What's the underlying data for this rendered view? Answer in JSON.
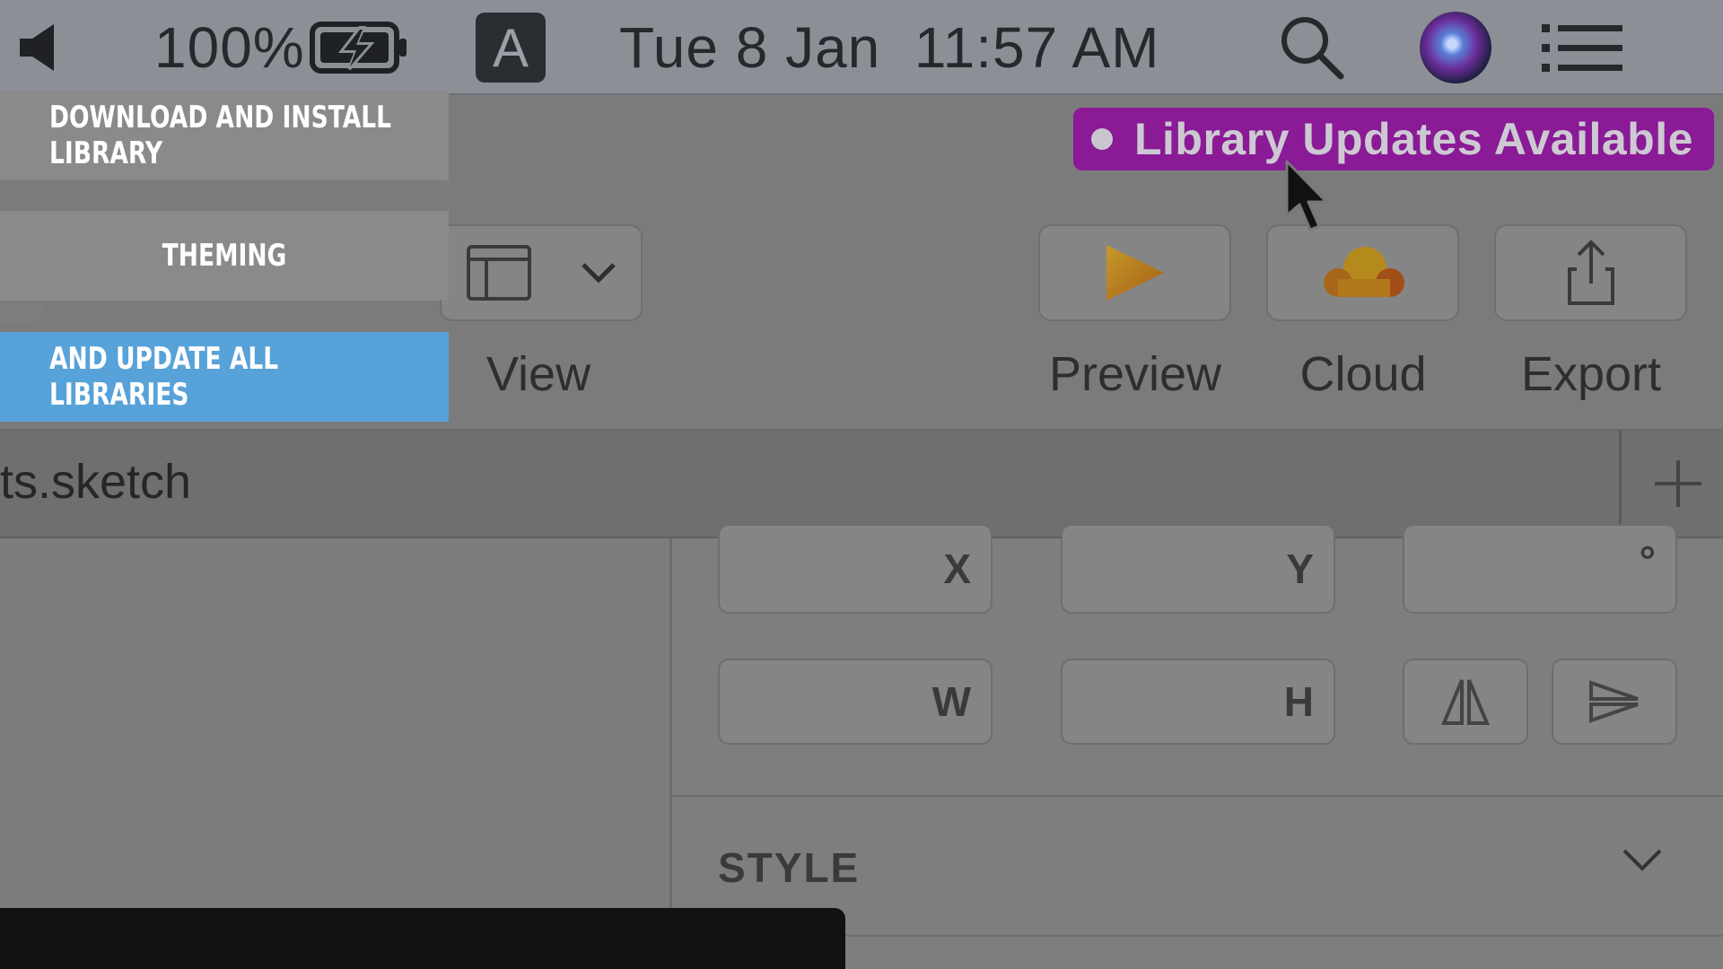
{
  "menubar": {
    "battery_percent": "100%",
    "input_source": "A",
    "datetime": "Tue 8 Jan  11:57 AM",
    "icons": [
      "speaker-icon",
      "battery-charging-icon",
      "search-icon",
      "siri-icon",
      "menu-list-icon"
    ]
  },
  "banner": {
    "label": "Library Updates Available",
    "color": "#8a1a96"
  },
  "toolbar": {
    "view_label": "View",
    "preview_label": "Preview",
    "cloud_label": "Cloud",
    "export_label": "Export"
  },
  "tab": {
    "title": "ts.sketch"
  },
  "inspector": {
    "x_label": "X",
    "y_label": "Y",
    "rotation_label": "°",
    "w_label": "W",
    "h_label": "H",
    "style_label": "STYLE"
  },
  "overlay": {
    "items": [
      {
        "label": "DOWNLOAD AND INSTALL LIBRARY"
      },
      {
        "label": "THEMING"
      },
      {
        "label": "AND UPDATE ALL LIBRARIES"
      }
    ],
    "highlight_color": "#57a2d8"
  }
}
